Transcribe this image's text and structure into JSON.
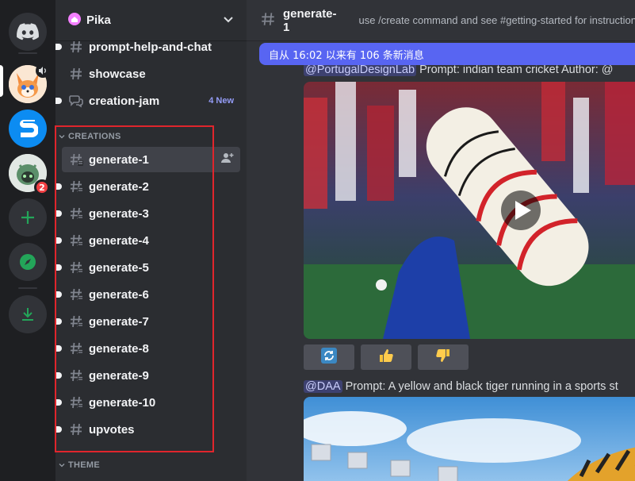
{
  "server_rail": {
    "items": [
      {
        "name": "Discord Home",
        "icon": "discord-logo-icon"
      },
      {
        "name": "Pika",
        "icon": "pika-server-icon"
      },
      {
        "name": "Shapes",
        "icon": "shapes-server-icon"
      },
      {
        "name": "Bot Server",
        "icon": "green-robot-server-icon",
        "badge": "2"
      },
      {
        "name": "Add a Server",
        "icon": "plus-icon"
      },
      {
        "name": "Explore Discoverable Servers",
        "icon": "compass-icon"
      },
      {
        "name": "Download Apps",
        "icon": "download-icon"
      }
    ]
  },
  "guild": {
    "name": "Pika",
    "icon": "house-icon"
  },
  "sidebar": {
    "channels_top": [
      {
        "label": "prompt-help-and-chat",
        "icon": "hash-icon"
      },
      {
        "label": "showcase",
        "icon": "hash-icon"
      },
      {
        "label": "creation-jam",
        "icon": "forum-icon",
        "tag": "4 New"
      }
    ],
    "category_creations": "CREATIONS",
    "creations": [
      {
        "label": "generate-1",
        "selected": true
      },
      {
        "label": "generate-2"
      },
      {
        "label": "generate-3"
      },
      {
        "label": "generate-4"
      },
      {
        "label": "generate-5"
      },
      {
        "label": "generate-6"
      },
      {
        "label": "generate-7"
      },
      {
        "label": "generate-8"
      },
      {
        "label": "generate-9"
      },
      {
        "label": "generate-10"
      },
      {
        "label": "upvotes"
      }
    ],
    "category_theme": "THEME"
  },
  "channel": {
    "title": "generate-1",
    "topic": "use /create command and see #getting-started for instructions",
    "new_messages_bar": "自从 16:02 以来有 106 条新消息"
  },
  "messages": [
    {
      "author_mention": "@PortugalDesignLab",
      "text": "Prompt: indian team cricket  Author: @"
    },
    {
      "author_mention": "@DAA",
      "text": "Prompt: A yellow and black tiger running in a sports st"
    }
  ],
  "colors": {
    "accent": "#5865f2",
    "green": "#23a559",
    "badge_red": "#f23f43",
    "highlight_box": "#e0252c"
  }
}
